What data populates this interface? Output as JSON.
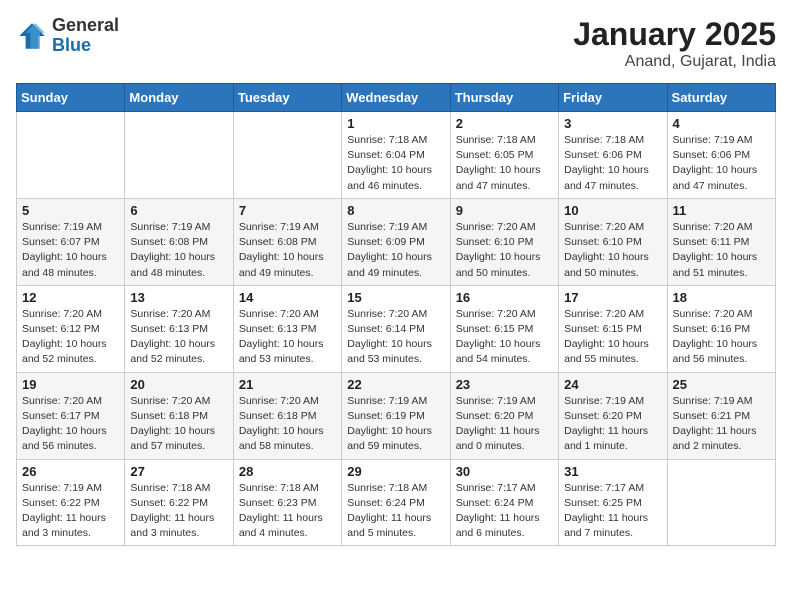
{
  "header": {
    "logo_general": "General",
    "logo_blue": "Blue",
    "month_title": "January 2025",
    "location": "Anand, Gujarat, India"
  },
  "weekdays": [
    "Sunday",
    "Monday",
    "Tuesday",
    "Wednesday",
    "Thursday",
    "Friday",
    "Saturday"
  ],
  "weeks": [
    [
      {
        "day": "",
        "content": ""
      },
      {
        "day": "",
        "content": ""
      },
      {
        "day": "",
        "content": ""
      },
      {
        "day": "1",
        "content": "Sunrise: 7:18 AM\nSunset: 6:04 PM\nDaylight: 10 hours\nand 46 minutes."
      },
      {
        "day": "2",
        "content": "Sunrise: 7:18 AM\nSunset: 6:05 PM\nDaylight: 10 hours\nand 47 minutes."
      },
      {
        "day": "3",
        "content": "Sunrise: 7:18 AM\nSunset: 6:06 PM\nDaylight: 10 hours\nand 47 minutes."
      },
      {
        "day": "4",
        "content": "Sunrise: 7:19 AM\nSunset: 6:06 PM\nDaylight: 10 hours\nand 47 minutes."
      }
    ],
    [
      {
        "day": "5",
        "content": "Sunrise: 7:19 AM\nSunset: 6:07 PM\nDaylight: 10 hours\nand 48 minutes."
      },
      {
        "day": "6",
        "content": "Sunrise: 7:19 AM\nSunset: 6:08 PM\nDaylight: 10 hours\nand 48 minutes."
      },
      {
        "day": "7",
        "content": "Sunrise: 7:19 AM\nSunset: 6:08 PM\nDaylight: 10 hours\nand 49 minutes."
      },
      {
        "day": "8",
        "content": "Sunrise: 7:19 AM\nSunset: 6:09 PM\nDaylight: 10 hours\nand 49 minutes."
      },
      {
        "day": "9",
        "content": "Sunrise: 7:20 AM\nSunset: 6:10 PM\nDaylight: 10 hours\nand 50 minutes."
      },
      {
        "day": "10",
        "content": "Sunrise: 7:20 AM\nSunset: 6:10 PM\nDaylight: 10 hours\nand 50 minutes."
      },
      {
        "day": "11",
        "content": "Sunrise: 7:20 AM\nSunset: 6:11 PM\nDaylight: 10 hours\nand 51 minutes."
      }
    ],
    [
      {
        "day": "12",
        "content": "Sunrise: 7:20 AM\nSunset: 6:12 PM\nDaylight: 10 hours\nand 52 minutes."
      },
      {
        "day": "13",
        "content": "Sunrise: 7:20 AM\nSunset: 6:13 PM\nDaylight: 10 hours\nand 52 minutes."
      },
      {
        "day": "14",
        "content": "Sunrise: 7:20 AM\nSunset: 6:13 PM\nDaylight: 10 hours\nand 53 minutes."
      },
      {
        "day": "15",
        "content": "Sunrise: 7:20 AM\nSunset: 6:14 PM\nDaylight: 10 hours\nand 53 minutes."
      },
      {
        "day": "16",
        "content": "Sunrise: 7:20 AM\nSunset: 6:15 PM\nDaylight: 10 hours\nand 54 minutes."
      },
      {
        "day": "17",
        "content": "Sunrise: 7:20 AM\nSunset: 6:15 PM\nDaylight: 10 hours\nand 55 minutes."
      },
      {
        "day": "18",
        "content": "Sunrise: 7:20 AM\nSunset: 6:16 PM\nDaylight: 10 hours\nand 56 minutes."
      }
    ],
    [
      {
        "day": "19",
        "content": "Sunrise: 7:20 AM\nSunset: 6:17 PM\nDaylight: 10 hours\nand 56 minutes."
      },
      {
        "day": "20",
        "content": "Sunrise: 7:20 AM\nSunset: 6:18 PM\nDaylight: 10 hours\nand 57 minutes."
      },
      {
        "day": "21",
        "content": "Sunrise: 7:20 AM\nSunset: 6:18 PM\nDaylight: 10 hours\nand 58 minutes."
      },
      {
        "day": "22",
        "content": "Sunrise: 7:19 AM\nSunset: 6:19 PM\nDaylight: 10 hours\nand 59 minutes."
      },
      {
        "day": "23",
        "content": "Sunrise: 7:19 AM\nSunset: 6:20 PM\nDaylight: 11 hours\nand 0 minutes."
      },
      {
        "day": "24",
        "content": "Sunrise: 7:19 AM\nSunset: 6:20 PM\nDaylight: 11 hours\nand 1 minute."
      },
      {
        "day": "25",
        "content": "Sunrise: 7:19 AM\nSunset: 6:21 PM\nDaylight: 11 hours\nand 2 minutes."
      }
    ],
    [
      {
        "day": "26",
        "content": "Sunrise: 7:19 AM\nSunset: 6:22 PM\nDaylight: 11 hours\nand 3 minutes."
      },
      {
        "day": "27",
        "content": "Sunrise: 7:18 AM\nSunset: 6:22 PM\nDaylight: 11 hours\nand 3 minutes."
      },
      {
        "day": "28",
        "content": "Sunrise: 7:18 AM\nSunset: 6:23 PM\nDaylight: 11 hours\nand 4 minutes."
      },
      {
        "day": "29",
        "content": "Sunrise: 7:18 AM\nSunset: 6:24 PM\nDaylight: 11 hours\nand 5 minutes."
      },
      {
        "day": "30",
        "content": "Sunrise: 7:17 AM\nSunset: 6:24 PM\nDaylight: 11 hours\nand 6 minutes."
      },
      {
        "day": "31",
        "content": "Sunrise: 7:17 AM\nSunset: 6:25 PM\nDaylight: 11 hours\nand 7 minutes."
      },
      {
        "day": "",
        "content": ""
      }
    ]
  ]
}
